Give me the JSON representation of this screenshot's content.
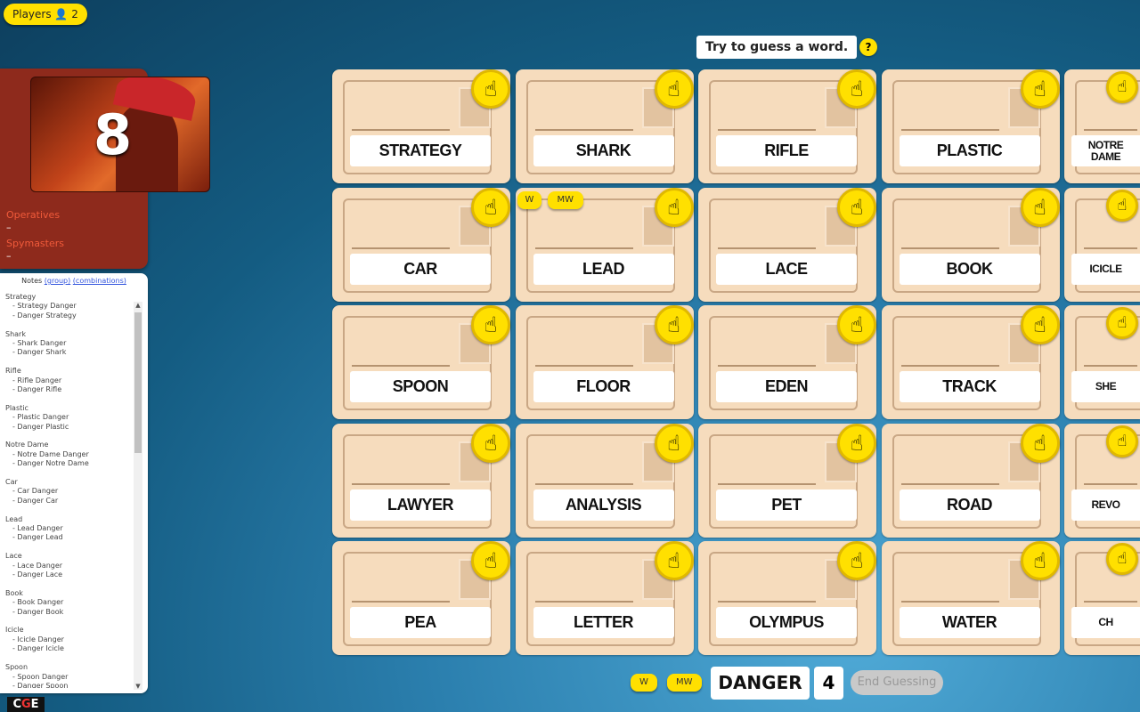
{
  "header": {
    "players_label": "Players",
    "players_count": "2",
    "prompt": "Try to guess a word.",
    "help": "?"
  },
  "team": {
    "score": "8",
    "operatives_label": "Operatives",
    "operatives_value": "–",
    "spymasters_label": "Spymasters",
    "spymasters_value": "–",
    "color": "#8e2a1c"
  },
  "notes": {
    "title": "Notes",
    "group_link": "(group)",
    "combinations_link": "(combinations)",
    "items": [
      {
        "word": "Strategy",
        "subs": [
          "- Strategy Danger",
          "- Danger Strategy"
        ]
      },
      {
        "word": "Shark",
        "subs": [
          "- Shark Danger",
          "- Danger Shark"
        ]
      },
      {
        "word": "Rifle",
        "subs": [
          "- Rifle Danger",
          "- Danger Rifle"
        ]
      },
      {
        "word": "Plastic",
        "subs": [
          "- Plastic Danger",
          "- Danger Plastic"
        ]
      },
      {
        "word": "Notre Dame",
        "subs": [
          "- Notre Dame Danger",
          "- Danger Notre Dame"
        ]
      },
      {
        "word": "Car",
        "subs": [
          "- Car Danger",
          "- Danger Car"
        ]
      },
      {
        "word": "Lead",
        "subs": [
          "- Lead Danger",
          "- Danger Lead"
        ]
      },
      {
        "word": "Lace",
        "subs": [
          "- Lace Danger",
          "- Danger Lace"
        ]
      },
      {
        "word": "Book",
        "subs": [
          "- Book Danger",
          "- Danger Book"
        ]
      },
      {
        "word": "Icicle",
        "subs": [
          "- Icicle Danger",
          "- Danger Icicle"
        ]
      },
      {
        "word": "Spoon",
        "subs": [
          "- Spoon Danger",
          "- Danger Spoon"
        ]
      }
    ]
  },
  "board": {
    "cards": [
      "STRATEGY",
      "SHARK",
      "RIFLE",
      "PLASTIC",
      "NOTRE DAME",
      "CAR",
      "LEAD",
      "LACE",
      "BOOK",
      "ICICLE",
      "SPOON",
      "FLOOR",
      "EDEN",
      "TRACK",
      "SHE",
      "LAWYER",
      "ANALYSIS",
      "PET",
      "ROAD",
      "REVO",
      "PEA",
      "LETTER",
      "OLYMPUS",
      "WATER",
      "CH"
    ],
    "card_tags": {
      "LEAD": [
        "W",
        "MW"
      ]
    }
  },
  "footer": {
    "w_label": "W",
    "mw_label": "MW",
    "clue": "DANGER",
    "count": "4",
    "end_label": "End Guessing"
  },
  "logo": "CGE"
}
